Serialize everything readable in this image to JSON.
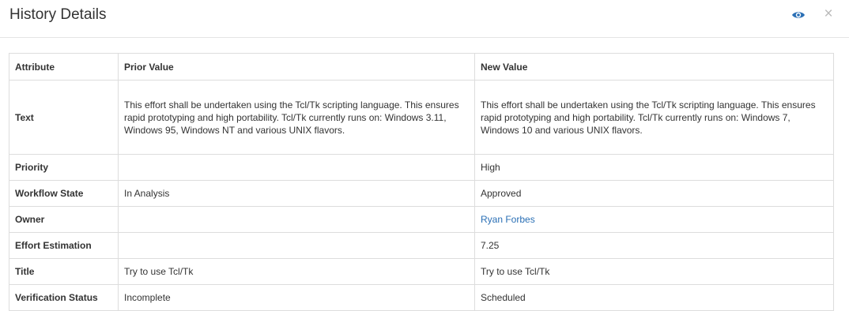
{
  "dialog": {
    "title": "History Details",
    "eye_icon": "eye-icon",
    "close_label": "×",
    "accent_color": "#2a6fb5"
  },
  "table": {
    "headers": {
      "attribute": "Attribute",
      "prior": "Prior Value",
      "new": "New Value"
    },
    "rows": [
      {
        "attribute": "Text",
        "prior": "This effort shall be undertaken using the Tcl/Tk scripting language. This ensures rapid prototyping and high portability. Tcl/Tk currently runs on: Windows 3.11, Windows 95, Windows NT and various UNIX flavors.",
        "new": "This effort shall be undertaken using the Tcl/Tk scripting language. This ensures rapid prototyping and high portability. Tcl/Tk currently runs on: Windows 7, Windows 10 and various UNIX flavors."
      },
      {
        "attribute": "Priority",
        "prior": "",
        "new": "High"
      },
      {
        "attribute": "Workflow State",
        "prior": "In Analysis",
        "new": "Approved"
      },
      {
        "attribute": "Owner",
        "prior": "",
        "new": "Ryan Forbes"
      },
      {
        "attribute": "Effort Estimation",
        "prior": "",
        "new": "7.25"
      },
      {
        "attribute": "Title",
        "prior": "Try to use Tcl/Tk",
        "new": "Try to use Tcl/Tk"
      },
      {
        "attribute": "Verification Status",
        "prior": "Incomplete",
        "new": "Scheduled"
      }
    ]
  }
}
